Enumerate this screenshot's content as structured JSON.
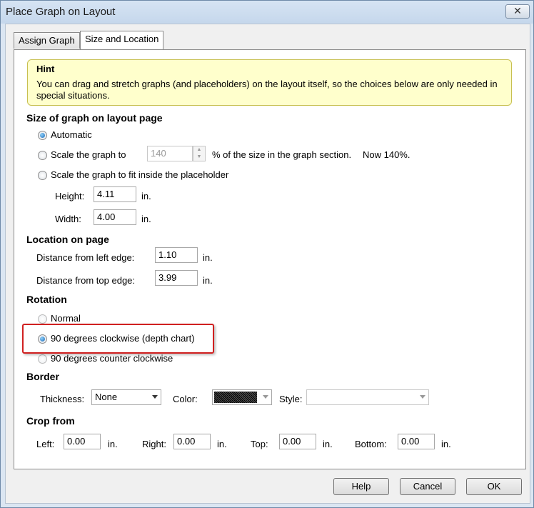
{
  "window": {
    "title": "Place Graph on Layout",
    "close_glyph": "✕"
  },
  "tabs": [
    {
      "label": "Assign Graph",
      "active": false
    },
    {
      "label": "Size and Location",
      "active": true
    }
  ],
  "hint": {
    "title": "Hint",
    "text": "You can drag and stretch graphs (and placeholders) on the layout itself, so the choices below are only needed in special situations."
  },
  "size": {
    "heading": "Size of graph on layout page",
    "automatic_label": "Automatic",
    "scale_label": "Scale the graph to",
    "scale_value": "140",
    "scale_suffix": "% of the size in the graph section.",
    "now_text": "Now 140%.",
    "fit_label": "Scale the graph to fit inside the placeholder",
    "height_label": "Height:",
    "height_value": "4.11",
    "height_unit": "in.",
    "width_label": "Width:",
    "width_value": "4.00",
    "width_unit": "in.",
    "selected": "Automatic"
  },
  "location": {
    "heading": "Location on page",
    "left_label": "Distance from left edge:",
    "left_value": "1.10",
    "left_unit": "in.",
    "top_label": "Distance from top edge:",
    "top_value": "3.99",
    "top_unit": "in."
  },
  "rotation": {
    "heading": "Rotation",
    "normal_label": "Normal",
    "cw_label": "90 degrees clockwise (depth chart)",
    "ccw_label": "90 degrees counter clockwise",
    "selected": "90 degrees clockwise (depth chart)"
  },
  "border": {
    "heading": "Border",
    "thickness_label": "Thickness:",
    "thickness_value": "None",
    "color_label": "Color:",
    "style_label": "Style:",
    "style_value": ""
  },
  "crop": {
    "heading": "Crop from",
    "left_label": "Left:",
    "left_value": "0.00",
    "left_unit": "in.",
    "right_label": "Right:",
    "right_value": "0.00",
    "right_unit": "in.",
    "top_label": "Top:",
    "top_value": "0.00",
    "top_unit": "in.",
    "bottom_label": "Bottom:",
    "bottom_value": "0.00",
    "bottom_unit": "in."
  },
  "buttons": {
    "help": "Help",
    "cancel": "Cancel",
    "ok": "OK"
  },
  "colors": {
    "highlight": "#d02020",
    "hint_bg": "#ffffcc",
    "radio_fill": "#1d6ab8"
  }
}
